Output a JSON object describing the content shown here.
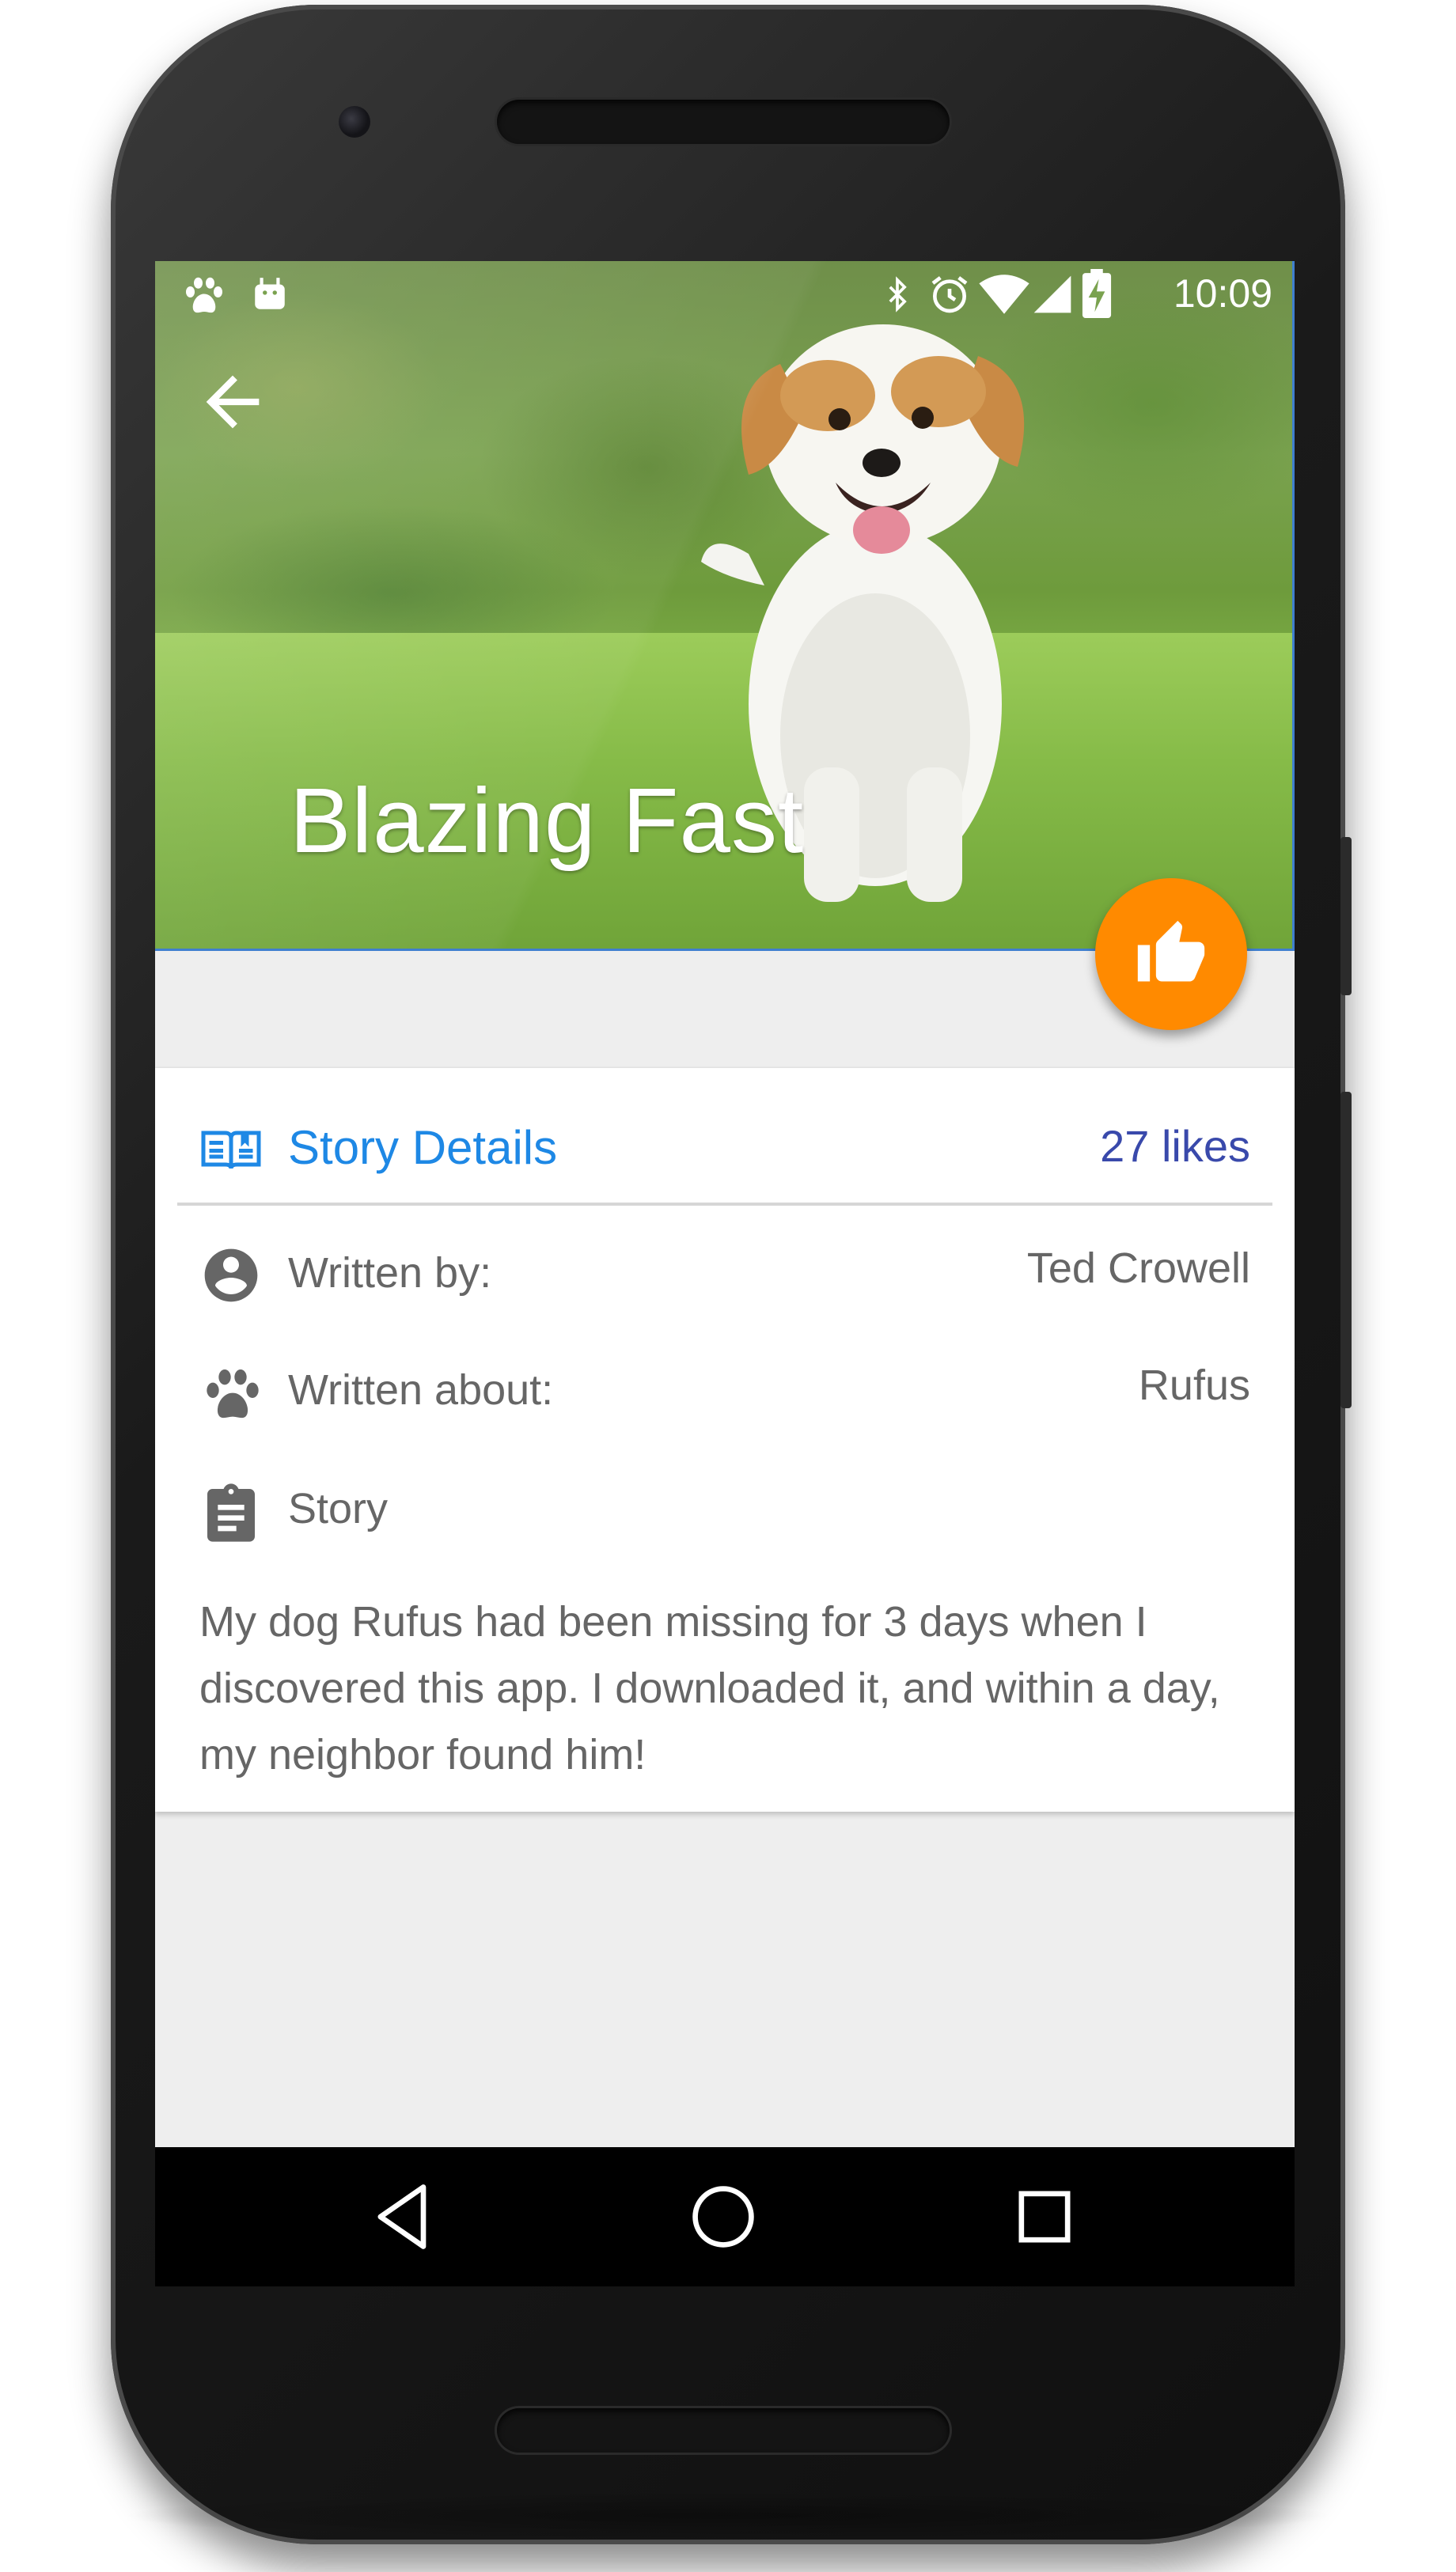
{
  "status_bar": {
    "time": "10:09",
    "left_icons": [
      "paw-notification-icon",
      "android-notification-icon"
    ],
    "right_icons": [
      "bluetooth-icon",
      "alarm-icon",
      "wifi-icon",
      "cell-signal-icon",
      "battery-charging-icon"
    ]
  },
  "toolbar": {
    "back_icon": "arrow-back-icon"
  },
  "hero": {
    "title": "Blazing Fast"
  },
  "fab": {
    "icon": "thumb-up-icon",
    "color": "#ff8a00"
  },
  "card": {
    "header": {
      "icon": "book-icon",
      "title": "Story Details",
      "likes": "27 likes"
    },
    "rows": [
      {
        "icon": "account-circle-icon",
        "label": "Written by:",
        "value": "Ted Crowell"
      },
      {
        "icon": "paw-icon",
        "label": "Written about:",
        "value": "Rufus"
      },
      {
        "icon": "clipboard-icon",
        "label": "Story",
        "value": ""
      }
    ],
    "story": "My dog Rufus had been missing for 3 days when I discovered this app. I downloaded it, and within a day, my neighbor found him!"
  },
  "nav_bar": {
    "buttons": [
      "nav-back-icon",
      "nav-home-icon",
      "nav-recents-icon"
    ]
  },
  "colors": {
    "accent_blue": "#1e88e5",
    "likes_indigo": "#3949ab",
    "fab_orange": "#ff8a00",
    "body_text": "#666666",
    "screen_background": "#eeeeee"
  }
}
